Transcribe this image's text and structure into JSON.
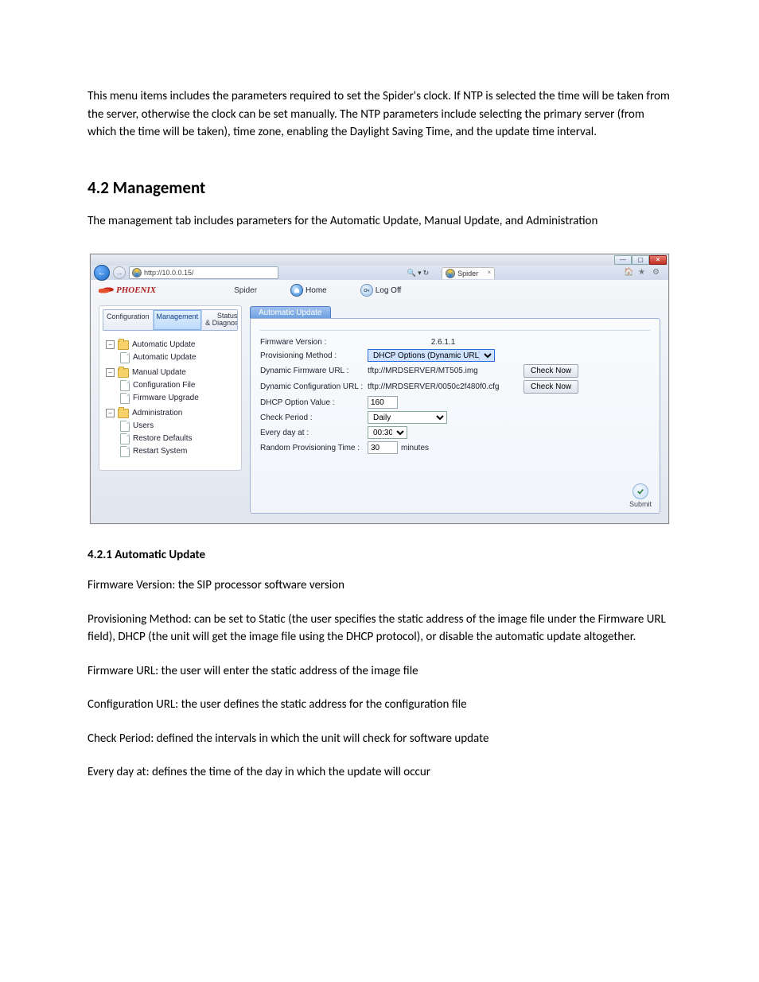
{
  "intro_paragraph": "This menu items includes the parameters required to set the Spider's clock. If NTP is selected the time will be taken from the server, otherwise the clock can be set manually. The NTP parameters include selecting the primary server (from which the time will be taken), time zone, enabling the Daylight Saving Time, and the update time interval.",
  "section_heading": "4.2 Management",
  "section_intro": "The management tab includes parameters for the Automatic Update, Manual Update, and Administration",
  "browser": {
    "url": "http://10.0.0.15/",
    "tab_title": "Spider",
    "search_glyph": "🔍",
    "refresh_glyph": "↻"
  },
  "app": {
    "logo_text": "PHOENIX",
    "label": "Spider",
    "home_label": "Home",
    "logoff_label": "Log Off"
  },
  "sidebar": {
    "tabs": {
      "configuration": "Configuration",
      "management": "Management",
      "status_line1": "Status",
      "status_line2": "& Diagnostics"
    },
    "groups": [
      {
        "label": "Automatic Update",
        "items": [
          {
            "label": "Automatic Update"
          }
        ]
      },
      {
        "label": "Manual Update",
        "items": [
          {
            "label": "Configuration File"
          },
          {
            "label": "Firmware Upgrade"
          }
        ]
      },
      {
        "label": "Administration",
        "items": [
          {
            "label": "Users"
          },
          {
            "label": "Restore Defaults"
          },
          {
            "label": "Restart System"
          }
        ]
      }
    ]
  },
  "panel": {
    "title": "Automatic Update",
    "rows": {
      "firmware_version": {
        "label": "Firmware Version :",
        "value": "2.6.1.1"
      },
      "provisioning_method": {
        "label": "Provisioning Method :",
        "value": "DHCP Options (Dynamic URL)"
      },
      "dynamic_firmware_url": {
        "label": "Dynamic Firmware URL :",
        "value": "tftp://MRDSERVER/MT505.img",
        "button": "Check Now"
      },
      "dynamic_config_url": {
        "label": "Dynamic Configuration URL :",
        "value": "tftp://MRDSERVER/0050c2f480f0.cfg",
        "button": "Check Now"
      },
      "dhcp_option_value": {
        "label": "DHCP Option Value :",
        "value": "160"
      },
      "check_period": {
        "label": "Check Period :",
        "value": "Daily"
      },
      "every_day_at": {
        "label": "Every day at :",
        "value": "00:30"
      },
      "random_provisioning_time": {
        "label": "Random Provisioning Time :",
        "value": "30",
        "unit": "minutes"
      }
    },
    "submit_label": "Submit"
  },
  "subsection_heading": "4.2.1    Automatic Update",
  "explanations": {
    "firmware_version": "Firmware Version: the SIP processor software version",
    "provisioning_method": "Provisioning Method: can be set to Static (the user specifies the static address of the image file under the Firmware URL field), DHCP (the unit will get the image file using the DHCP protocol), or disable the automatic update altogether.",
    "firmware_url": "Firmware URL: the user will enter the static address of the image file",
    "configuration_url": "Configuration URL: the user defines the static address for the configuration file",
    "check_period": "Check Period: defined the intervals in which the unit will check for software update",
    "every_day_at": "Every day at: defines the time of the day in which the update will occur"
  }
}
